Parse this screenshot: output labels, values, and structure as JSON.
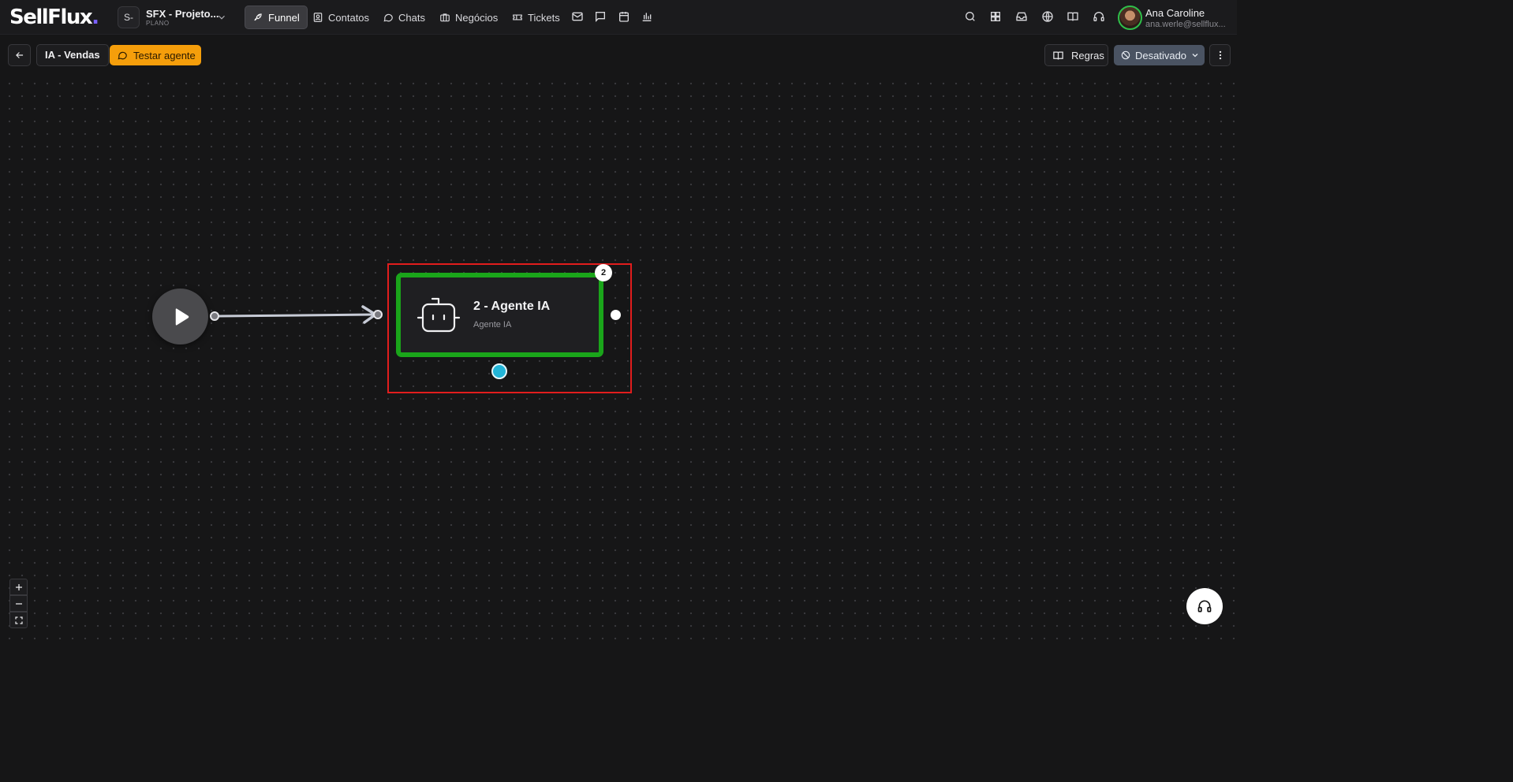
{
  "brand": {
    "logo_text": "SellFlux",
    "logo_dot": "."
  },
  "project": {
    "badge": "S-",
    "name": "SFX - Projeto...",
    "plan": "PLANO"
  },
  "nav": {
    "items": [
      {
        "label": "Funnel",
        "icon": "rocket-icon",
        "active": true
      },
      {
        "label": "Contatos",
        "icon": "contacts-icon",
        "active": false
      },
      {
        "label": "Chats",
        "icon": "chat-bubble-icon",
        "active": false
      },
      {
        "label": "Negócios",
        "icon": "briefcase-icon",
        "active": false
      },
      {
        "label": "Tickets",
        "icon": "ticket-icon",
        "active": false
      }
    ],
    "icon_items": [
      "mail-icon",
      "message-square-icon",
      "calendar-icon",
      "bar-chart-icon"
    ]
  },
  "header_right": {
    "icons": [
      "search-icon",
      "grid-icon",
      "inbox-icon",
      "globe-icon",
      "book-icon",
      "headset-icon"
    ]
  },
  "user": {
    "name": "Ana Caroline",
    "email": "ana.werle@sellflux..."
  },
  "toolbar": {
    "flow_name": "IA - Vendas",
    "test_label": "Testar agente",
    "rules_label": "Regras",
    "status_label": "Desativado"
  },
  "canvas": {
    "agent_node": {
      "title": "2 - Agente IA",
      "subtitle": "Agente IA",
      "badge": "2"
    }
  },
  "colors": {
    "accent_orange": "#f59e0b",
    "node_selected_green": "#1aa51a",
    "selection_red": "#e11d1d",
    "port_cyan": "#22b5d8",
    "status_gray": "#4a5362"
  }
}
